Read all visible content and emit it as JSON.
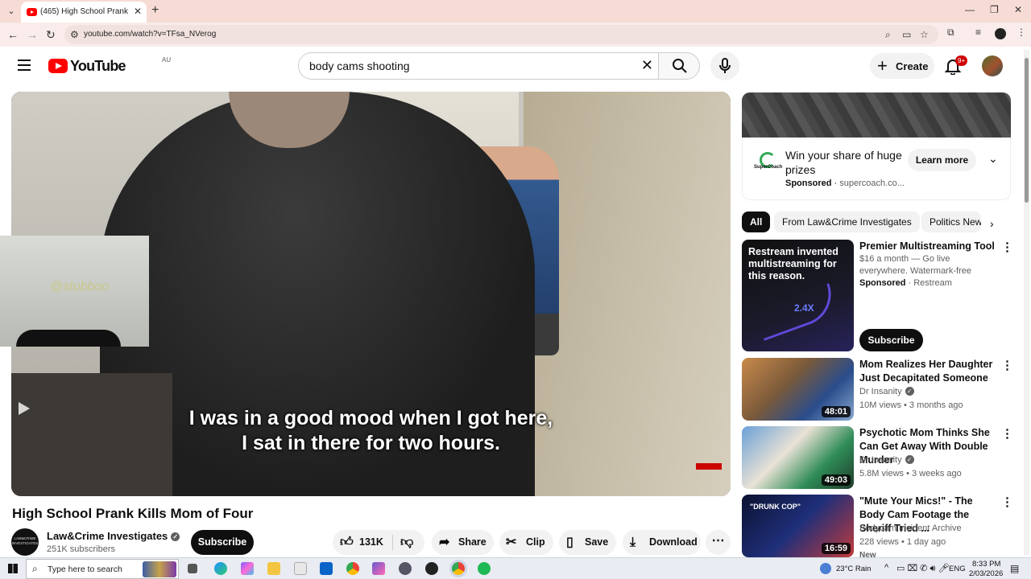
{
  "browser": {
    "tab_title": "(465) High School Prank Kills Mom of Four - YouTube",
    "url": "youtube.com/watch?v=TFsa_NVerog"
  },
  "header": {
    "logo_text": "YouTube",
    "region": "AU",
    "search_value": "body cams shooting",
    "create_label": "Create",
    "notification_count": "9+"
  },
  "player": {
    "caption_line1": "I was in a good mood when I got here,",
    "caption_line2": "I sat in there for two hours.",
    "overlay_watermark": "@stubboo"
  },
  "video": {
    "title": "High School Prank Kills Mom of Four",
    "channel_name": "Law&Crime Investigates",
    "channel_avatar_text": "LAW&CRIME INVESTIGATES",
    "subscribers": "251K subscribers",
    "subscribe_label": "Subscribe",
    "likes": "131K",
    "share_label": "Share",
    "clip_label": "Clip",
    "save_label": "Save",
    "download_label": "Download"
  },
  "ad": {
    "title": "Win your share of huge prizes",
    "sponsored": "Sponsored",
    "domain": "supercoach.co...",
    "logo_text": "SuperCoach",
    "learn_more": "Learn more"
  },
  "chips": [
    "All",
    "From Law&Crime Investigates",
    "Politics News"
  ],
  "promo": {
    "thumb_text": "Restream invented multistreaming for this reason.",
    "thumb_stat": "2.4X",
    "title": "Premier Multistreaming Tool",
    "description": "$16 a month — Go live everywhere. Watermark-free",
    "sponsored": "Sponsored",
    "advertiser": "Restream",
    "subscribe_label": "Subscribe"
  },
  "recommendations": [
    {
      "title": "Mom Realizes Her Daughter Just Decapitated Someone",
      "channel": "Dr Insanity",
      "meta": "10M views • 3 months ago",
      "duration": "48:01"
    },
    {
      "title": "Psychotic Mom Thinks She Can Get Away With Double Murder",
      "channel": "Dr Insanity",
      "meta": "5.8M views • 3 weeks ago",
      "duration": "49:03"
    },
    {
      "title": "\"Mute Your Mics!\" - The Body Cam Footage the Sheriff Tried ...",
      "channel": "Bodycam Incident Archive",
      "meta": "228 views • 1 day ago",
      "duration": "16:59",
      "badge": "New",
      "thumb_text": "\"DRUNK COP\""
    }
  ],
  "taskbar": {
    "search_placeholder": "Type here to search",
    "weather": "23°C  Rain",
    "language": "ENG",
    "time": "8:33 PM",
    "date": "2/03/2026"
  }
}
